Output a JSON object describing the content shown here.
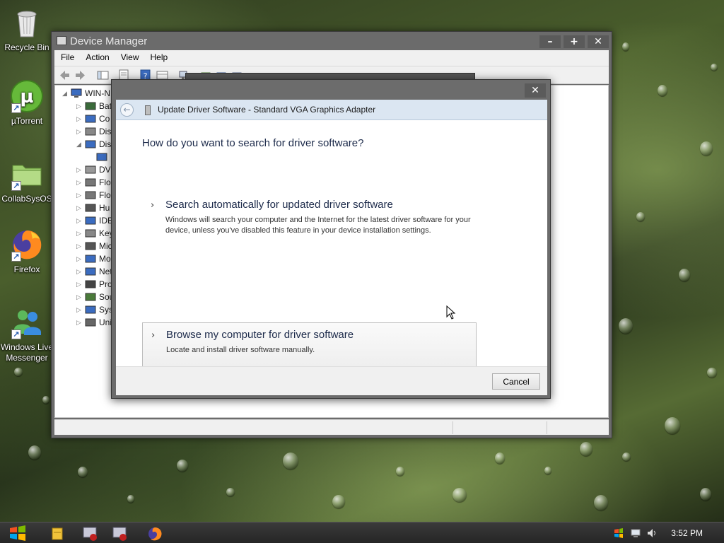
{
  "desktop": {
    "icons": [
      {
        "label": "Recycle Bin"
      },
      {
        "label": "µTorrent"
      },
      {
        "label": "CollabSysOS"
      },
      {
        "label": "Firefox"
      },
      {
        "label": "Windows Live\nMessenger"
      }
    ]
  },
  "device_manager": {
    "title": "Device Manager",
    "menu": [
      "File",
      "Action",
      "View",
      "Help"
    ],
    "tree_root": "WIN-N",
    "tree_items": [
      "Bat",
      "Co",
      "Dis",
      "Dis",
      "",
      "DVI",
      "Flo",
      "Flo",
      "Hu",
      "IDE",
      "Key",
      "Mic",
      "Mo",
      "Net",
      "Pro",
      "Sou",
      "Sys",
      "Uni"
    ]
  },
  "wizard": {
    "header_title": "Update Driver Software - Standard VGA Graphics Adapter",
    "question": "How do you want to search for driver software?",
    "option_auto": {
      "title": "Search automatically for updated driver software",
      "description": "Windows will search your computer and the Internet for the latest driver software for your device, unless you've disabled this feature in your device installation settings."
    },
    "option_browse": {
      "title": "Browse my computer for driver software",
      "description": "Locate and install driver software manually."
    },
    "cancel_label": "Cancel",
    "close_glyph": "✕"
  },
  "taskbar": {
    "clock": "3:52 PM"
  },
  "colors": {
    "header_band": "#dbe6f2",
    "window_frame": "#6b6b6b",
    "taskbar": "#2b2b2b"
  }
}
